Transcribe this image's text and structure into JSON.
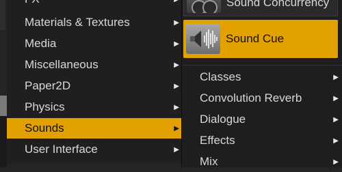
{
  "categories": {
    "items": [
      {
        "label": "FX"
      },
      {
        "label": "Materials & Textures"
      },
      {
        "label": "Media"
      },
      {
        "label": "Miscellaneous"
      },
      {
        "label": "Paper2D"
      },
      {
        "label": "Physics"
      },
      {
        "label": "Sounds"
      },
      {
        "label": "User Interface"
      }
    ],
    "active": "Sounds"
  },
  "sounds": {
    "assets": [
      {
        "label": "Sound Concurrency"
      },
      {
        "label": "Sound Cue"
      }
    ],
    "subcategories": [
      {
        "label": "Classes"
      },
      {
        "label": "Convolution Reverb"
      },
      {
        "label": "Dialogue"
      },
      {
        "label": "Effects"
      },
      {
        "label": "Mix"
      }
    ]
  },
  "colors": {
    "highlight": "#e2a100",
    "menu_bg": "#1f1f1f",
    "text": "#d8d8d8"
  },
  "icons": {
    "submenu_arrow": "▶",
    "sound_asset": "speaker-waveform-icon"
  }
}
